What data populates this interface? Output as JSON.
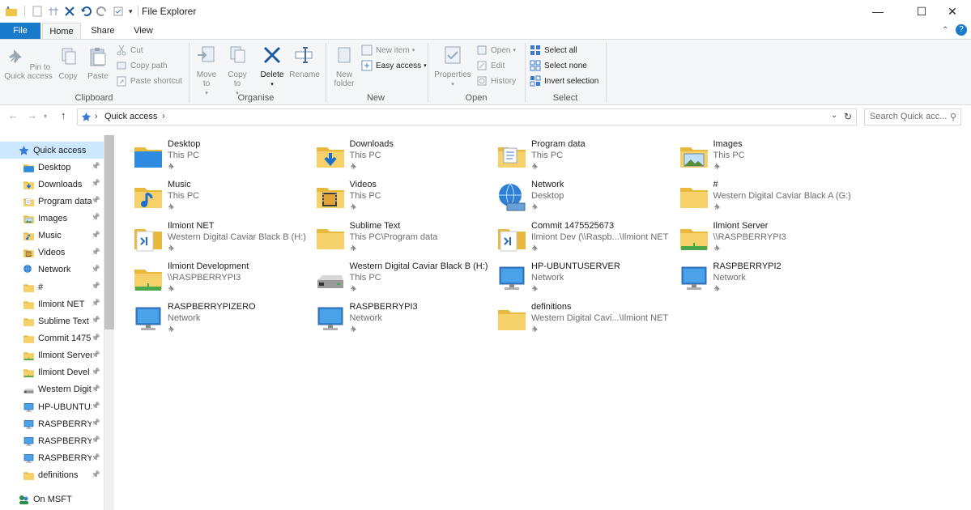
{
  "window": {
    "title": "File Explorer",
    "controls": {
      "minimize": "—",
      "maximize": "☐",
      "close": "✕"
    }
  },
  "ribbon": {
    "tabs": [
      {
        "label": "File"
      },
      {
        "label": "Home"
      },
      {
        "label": "Share"
      },
      {
        "label": "View"
      }
    ],
    "clipboard": {
      "group": "Clipboard",
      "pin": "Pin to Quick access",
      "copy": "Copy",
      "paste": "Paste",
      "cut": "Cut",
      "copy_path": "Copy path",
      "paste_shortcut": "Paste shortcut"
    },
    "organise": {
      "group": "Organise",
      "move_to": "Move to",
      "copy_to": "Copy to",
      "delete": "Delete",
      "rename": "Rename"
    },
    "new": {
      "group": "New",
      "new_folder": "New folder",
      "new_item": "New item",
      "easy_access": "Easy access"
    },
    "open": {
      "group": "Open",
      "properties": "Properties",
      "open": "Open",
      "edit": "Edit",
      "history": "History"
    },
    "select": {
      "group": "Select",
      "select_all": "Select all",
      "select_none": "Select none",
      "invert": "Invert selection"
    }
  },
  "address": {
    "path": "Quick access",
    "search_placeholder": "Search Quick acc..."
  },
  "navpane": {
    "quick_access": "Quick access",
    "items": [
      {
        "label": "Desktop",
        "icon": "desktop-icon"
      },
      {
        "label": "Downloads",
        "icon": "downloads-icon"
      },
      {
        "label": "Program data",
        "icon": "doc-folder-icon"
      },
      {
        "label": "Images",
        "icon": "images-icon"
      },
      {
        "label": "Music",
        "icon": "music-icon"
      },
      {
        "label": "Videos",
        "icon": "videos-icon"
      },
      {
        "label": "Network",
        "icon": "network-icon"
      },
      {
        "label": "#",
        "icon": "folder-icon"
      },
      {
        "label": "Ilmiont NET",
        "icon": "folder-icon"
      },
      {
        "label": "Sublime Text",
        "icon": "folder-icon"
      },
      {
        "label": "Commit 1475",
        "icon": "folder-icon"
      },
      {
        "label": "Ilmiont Server",
        "icon": "net-folder-icon"
      },
      {
        "label": "Ilmiont Devel",
        "icon": "net-folder-icon"
      },
      {
        "label": "Western Digit",
        "icon": "drive-icon"
      },
      {
        "label": "HP-UBUNTUS",
        "icon": "computer-icon"
      },
      {
        "label": "RASPBERRYPI",
        "icon": "computer-icon"
      },
      {
        "label": "RASPBERRYPI",
        "icon": "computer-icon"
      },
      {
        "label": "RASPBERRYPI",
        "icon": "computer-icon"
      },
      {
        "label": "definitions",
        "icon": "folder-icon"
      }
    ],
    "on_msft": "On MSFT"
  },
  "tiles": [
    {
      "name": "Desktop",
      "loc": "This PC",
      "icon": "desktop-icon"
    },
    {
      "name": "Downloads",
      "loc": "This PC",
      "icon": "downloads-icon"
    },
    {
      "name": "Program data",
      "loc": "This PC",
      "icon": "doc-folder-icon"
    },
    {
      "name": "Images",
      "loc": "This PC",
      "icon": "images-icon"
    },
    {
      "name": "Music",
      "loc": "This PC",
      "icon": "music-icon"
    },
    {
      "name": "Videos",
      "loc": "This PC",
      "icon": "videos-icon"
    },
    {
      "name": "Network",
      "loc": "Desktop",
      "icon": "network-globe-icon"
    },
    {
      "name": "#",
      "loc": "Western Digital Caviar Black A (G:)",
      "icon": "folder-icon"
    },
    {
      "name": "Ilmiont NET",
      "loc": "Western Digital Caviar Black B (H:)",
      "icon": "vs-folder-icon"
    },
    {
      "name": "Sublime Text",
      "loc": "This PC\\Program data",
      "icon": "folder-icon"
    },
    {
      "name": "Commit 1475525673",
      "loc": "Ilmiont Dev (\\\\Raspb...\\Ilmiont NET",
      "icon": "vs-folder-icon"
    },
    {
      "name": "Ilmiont Server",
      "loc": "\\\\RASPBERRYPI3",
      "icon": "net-folder-icon"
    },
    {
      "name": "Ilmiont Development",
      "loc": "\\\\RASPBERRYPI3",
      "icon": "net-folder-icon"
    },
    {
      "name": "Western Digital Caviar Black B (H:)",
      "loc": "This PC",
      "icon": "drive-icon"
    },
    {
      "name": "HP-UBUNTUSERVER",
      "loc": "Network",
      "icon": "computer-icon"
    },
    {
      "name": "RASPBERRYPI2",
      "loc": "Network",
      "icon": "computer-icon"
    },
    {
      "name": "RASPBERRYPIZERO",
      "loc": "Network",
      "icon": "computer-icon"
    },
    {
      "name": "RASPBERRYPI3",
      "loc": "Network",
      "icon": "computer-icon"
    },
    {
      "name": "definitions",
      "loc": "Western Digital Cavi...\\Ilmiont NET",
      "icon": "folder-icon"
    }
  ],
  "colors": {
    "accent": "#1979ca",
    "selection": "#cce8ff",
    "folder": "#f0c64a"
  }
}
